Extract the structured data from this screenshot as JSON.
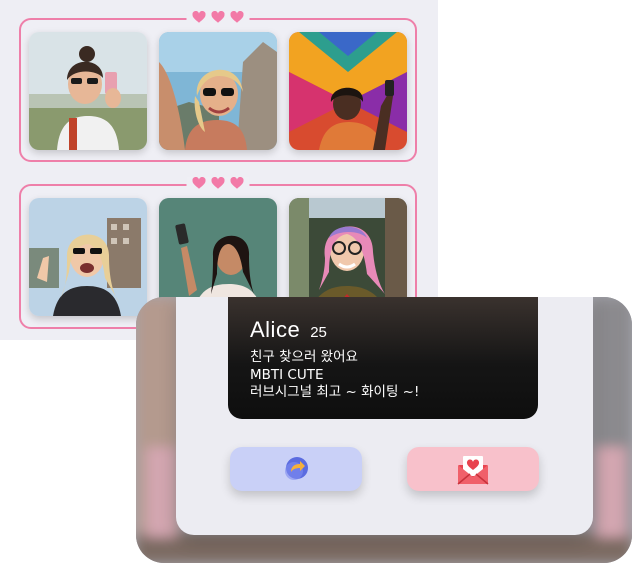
{
  "profile": {
    "name": "Alice",
    "age": "25",
    "lines": [
      "친구 찾으러 왔어요",
      "MBTI CUTE",
      "러브시그널 최고 ~ 화이팅 ~!"
    ]
  },
  "grids": [
    {
      "decoration": "three-hearts",
      "photos": [
        "woman-sunglasses-selfie-photo",
        "woman-sunglasses-sunny-photo",
        "woman-colorful-wall-photo"
      ]
    },
    {
      "decoration": "three-hearts",
      "photos": [
        "woman-laughing-city-photo",
        "woman-selfie-green-wall-photo",
        "woman-pink-hair-glasses-photo"
      ]
    }
  ],
  "buttons": {
    "share_icon": "share-forward-icon",
    "mail_icon": "love-letter-icon"
  },
  "colors": {
    "grid_border": "#ee7fa9",
    "heart": "#f27aa7",
    "share_button": "#c9d0f7",
    "mail_button": "#f8c1cb",
    "profile_bg": "#121212"
  }
}
